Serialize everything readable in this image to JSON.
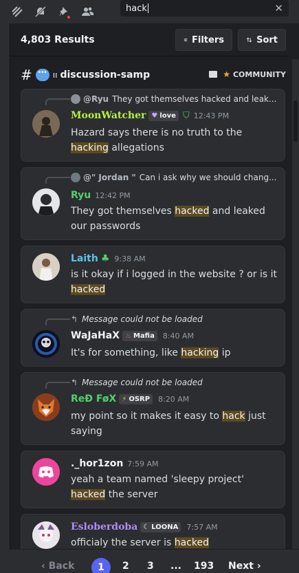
{
  "toolbar": {
    "icons": [
      "threads-icon",
      "muted-bell-icon",
      "pin-icon",
      "members-icon"
    ]
  },
  "search": {
    "value": "hack",
    "clear_icon": "close-icon"
  },
  "results": {
    "count": "4,803 Results",
    "filters_label": "Filters",
    "sort_label": "Sort"
  },
  "channel": {
    "hash": "#",
    "name": "discussion-samp",
    "category": "COMMUNITY"
  },
  "messages": [
    {
      "reply_name": "@Ryu",
      "reply_text": "They got themselves hacked and leak...",
      "author": "MoonWatcher",
      "author_color": "#b8f33a",
      "tag": "love",
      "time": "12:43 PM",
      "body_pre": "Hazard says there is no truth to the ",
      "body_hl": "hacking",
      "body_post": " allegations"
    },
    {
      "reply_name": "@\" Jordan \"",
      "reply_text": "Can i ask why we should chang...",
      "author": "Ryu",
      "author_color": "#4fd16b",
      "time": "12:42 PM",
      "body_pre": "They got themselves ",
      "body_hl": "hacked",
      "body_post": " and leaked our passwords"
    },
    {
      "author": "Laith",
      "author_color": "#5fc1ea",
      "time": "9:38 AM",
      "body_pre": "is it okay if i logged in the website ? or is it ",
      "body_hl": "hacked",
      "body_post": ""
    },
    {
      "reply_text": "Message could not be loaded",
      "author": "WaJaHaX",
      "author_color": "#f2f3f5",
      "tag": "Mafia",
      "time": "8:40 AM",
      "body_pre": "It's for something, like ",
      "body_hl": "hacking",
      "body_post": " ip"
    },
    {
      "reply_text": "Message could not be loaded",
      "author": "ReÐ FøX",
      "author_color": "#4fd16b",
      "tag": "OSRP",
      "time": "8:20 AM",
      "body_pre": "my point so it makes it easy to ",
      "body_hl": "hack",
      "body_post": " just saying"
    },
    {
      "author": "._hor1zon",
      "author_color": "#f2f3f5",
      "time": "7:59 AM",
      "body_pre": "yeah a team named 'sleepy project' ",
      "body_hl": "hacked",
      "body_post": " the server"
    },
    {
      "author": "Esloberdoba",
      "author_color": "#b28cf2",
      "tag": "LOONA",
      "time": "7:57 AM",
      "body_pre": "officialy the server is ",
      "body_hl": "hacked",
      "body_post": ""
    }
  ],
  "pagination": {
    "back": "Back",
    "pages": [
      "1",
      "2",
      "3",
      "...",
      "193"
    ],
    "next": "Next"
  }
}
